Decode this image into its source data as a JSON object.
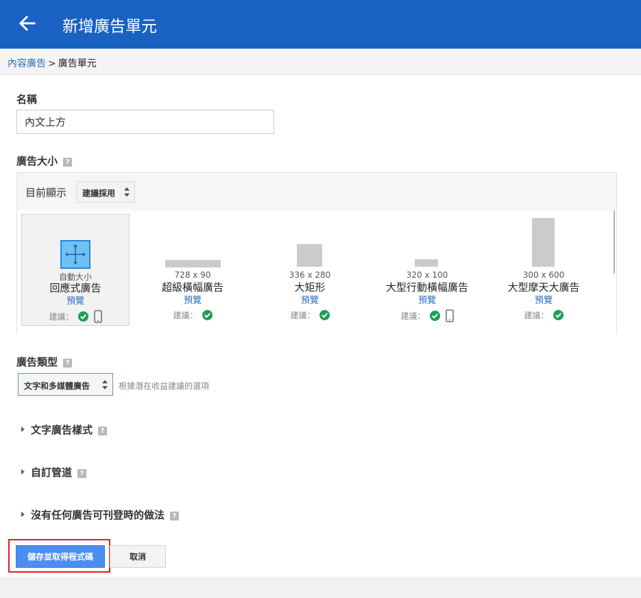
{
  "header": {
    "title": "新增廣告單元",
    "back_icon": "arrow-left-icon",
    "color": "#1a62c1"
  },
  "breadcrumb": {
    "parent": "內容廣告",
    "separator": ">",
    "current": "廣告單元"
  },
  "form": {
    "name": {
      "label": "名稱",
      "value": "內文上方"
    },
    "ad_size": {
      "label": "廣告大小",
      "display_label": "目前顯示",
      "filter_value": "建議採用",
      "sizes": [
        {
          "dims": "自動大小",
          "name": "回應式廣告",
          "preview": "預覽",
          "recommend": "建議：",
          "mobile": true,
          "selected": true
        },
        {
          "dims": "728 x 90",
          "name": "超級橫幅廣告",
          "preview": "預覽",
          "recommend": "建議：",
          "mobile": false,
          "selected": false
        },
        {
          "dims": "336 x 280",
          "name": "大矩形",
          "preview": "預覽",
          "recommend": "建議：",
          "mobile": false,
          "selected": false
        },
        {
          "dims": "320 x 100",
          "name": "大型行動橫幅廣告",
          "preview": "預覽",
          "recommend": "建議：",
          "mobile": true,
          "selected": false
        },
        {
          "dims": "300 x 600",
          "name": "大型摩天大廣告",
          "preview": "預覽",
          "recommend": "建議：",
          "mobile": false,
          "selected": false
        }
      ]
    },
    "ad_type": {
      "label": "廣告類型",
      "value": "文字和多媒體廣告",
      "hint": "根據潛在收益建議的選項"
    },
    "sections": [
      {
        "label": "文字廣告樣式"
      },
      {
        "label": "自訂管道"
      },
      {
        "label": "沒有任何廣告可刊登時的做法"
      }
    ],
    "help_glyph": "?"
  },
  "actions": {
    "save_label": "儲存並取得程式碼",
    "cancel_label": "取消"
  },
  "colors": {
    "accent": "#4a8ef0",
    "link": "#2a6ebf",
    "check": "#1e9e58",
    "highlight": "#e11b23"
  }
}
